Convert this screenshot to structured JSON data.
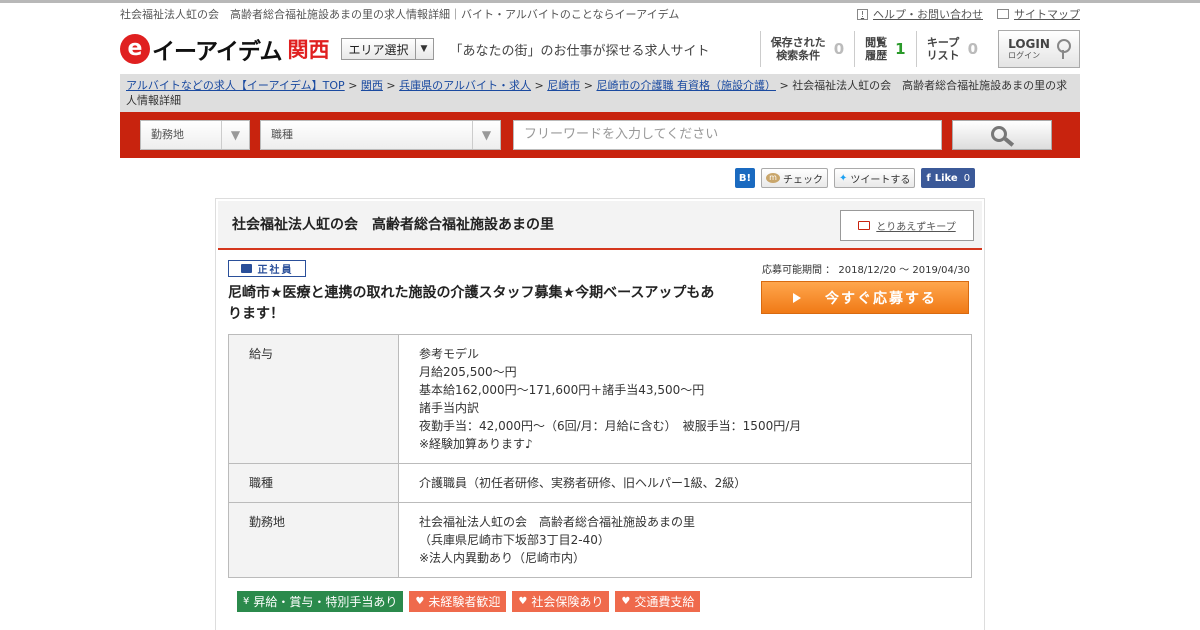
{
  "topbar": {
    "page_title": "社会福祉法人虹の会　高齢者総合福祉施設あまの里の求人情報詳細｜バイト・アルバイトのことならイーアイデム",
    "help_link": "ヘルプ・お問い合わせ",
    "sitemap_link": "サイトマップ"
  },
  "header": {
    "logo_mark": "e",
    "logo_text": "イーアイデム",
    "logo_region": "関西",
    "area_select": "エリア選択",
    "tagline": "「あなたの街」のお仕事が探せる求人サイト",
    "stats": [
      {
        "label_line1": "保存された",
        "label_line2": "検索条件",
        "value": "0"
      },
      {
        "label_line1": "閲覧",
        "label_line2": "履歴",
        "value": "1"
      },
      {
        "label_line1": "キープ",
        "label_line2": "リスト",
        "value": "0"
      }
    ],
    "login_label": "LOGIN",
    "login_sub": "ログイン"
  },
  "breadcrumb": {
    "links": [
      "アルバイトなどの求人【イーアイデム】TOP",
      "関西",
      "兵庫県のアルバイト・求人",
      "尼崎市",
      "尼崎市の介護職 有資格（施設介護）"
    ],
    "current": "社会福祉法人虹の会　高齢者総合福祉施設あまの里の求人情報詳細"
  },
  "search": {
    "location": "勤務地",
    "job_type": "職種",
    "keyword_placeholder": "フリーワードを入力してください"
  },
  "social": {
    "hatena": "B!",
    "mixi": "チェック",
    "tweet": "ツイートする",
    "fb_like": "Like",
    "fb_count": "0"
  },
  "job": {
    "company": "社会福祉法人虹の会　高齢者総合福祉施設あまの里",
    "keep_button": "とりあえずキープ",
    "employment_type": "正社員",
    "period": "応募可能期間 ： 2018/12/20 ～ 2019/04/30",
    "title": "尼崎市★医療と連携の取れた施設の介護スタッフ募集★今期ベースアップもあります！",
    "apply_button": "今すぐ応募する",
    "details": [
      {
        "label": "給与",
        "lines": [
          "参考モデル",
          "月給205,500〜円",
          "基本給162,000円〜171,600円＋諸手当43,500〜円",
          "諸手当内訳",
          "夜勤手当：42,000円〜（6回/月：月給に含む）　被服手当：1500円/月",
          "※経験加算あります♪"
        ]
      },
      {
        "label": "職種",
        "lines": [
          "介護職員（初任者研修、実務者研修、旧ヘルパー1級、2級）"
        ]
      },
      {
        "label": "勤務地",
        "lines": [
          "社会福祉法人虹の会　高齢者総合福祉施設あまの里",
          "（兵庫県尼崎市下坂部3丁目2-40）",
          "※法人内異動あり（尼崎市内）"
        ]
      }
    ],
    "tags": [
      {
        "icon": "¥",
        "label": "昇給・賞与・特別手当あり",
        "color": "#2b8a4c"
      },
      {
        "icon": "♥",
        "label": "未経験者歓迎",
        "color": "#ef6a4c"
      },
      {
        "icon": "♥",
        "label": "社会保険あり",
        "color": "#ef6a4c"
      },
      {
        "icon": "♥",
        "label": "交通費支給",
        "color": "#ef6a4c"
      }
    ]
  },
  "colors": {
    "brand_red": "#c8230e",
    "accent_orange": "#f07a16",
    "link_blue": "#1a4aa0"
  }
}
